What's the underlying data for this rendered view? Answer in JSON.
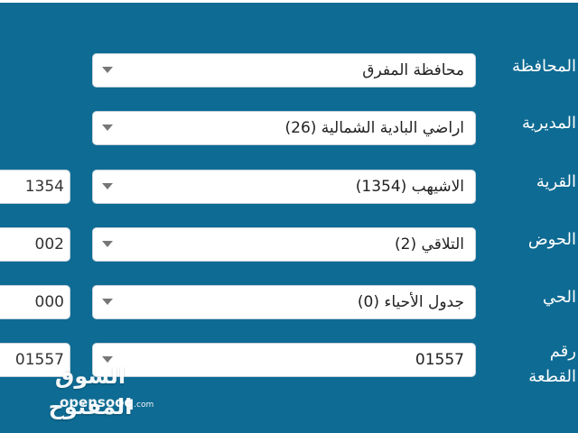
{
  "form": {
    "rows": [
      {
        "label": "المحافظة",
        "value": "محافظة المفرق",
        "code": ""
      },
      {
        "label": "المديرية",
        "value": "اراضي البادية الشمالية (26)",
        "code": ""
      },
      {
        "label": "القرية",
        "value": "الاشيهب (1354)",
        "code": "1354"
      },
      {
        "label": "الحوض",
        "value": "التلاقي (2)",
        "code": "002"
      },
      {
        "label": "الحي",
        "value": "جدول الأحياء (0)",
        "code": "000"
      },
      {
        "label": "رقم القطعة",
        "value": "01557",
        "code": "01557"
      }
    ]
  },
  "watermark": {
    "arabic": "السوق المفتوح",
    "latin": "opensooq",
    "suffix": ".com"
  },
  "colors": {
    "background": "#0e6b93",
    "field": "#ffffff",
    "text": "#222222"
  },
  "icons": {
    "dropdown": "chevron-down-icon"
  }
}
